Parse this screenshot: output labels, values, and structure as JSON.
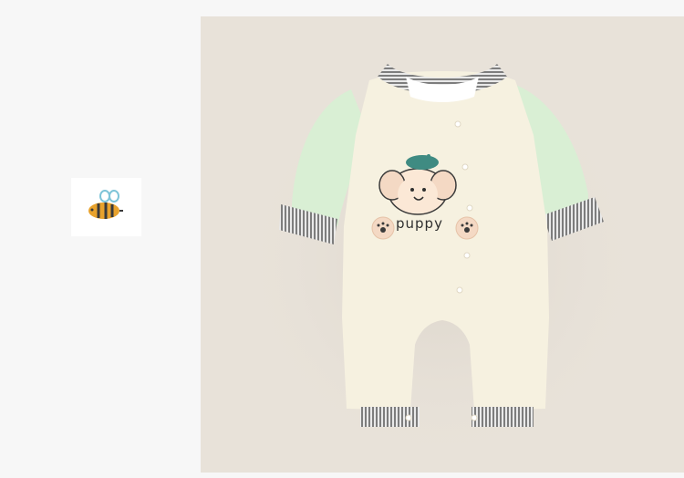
{
  "thumbnail": {
    "icon": "bee-icon"
  },
  "product_photo": {
    "print_text": "puppy",
    "colors": {
      "background": "#e8e2d9",
      "body": "#f6f1e0",
      "sleeves": "#d9efd4",
      "stripe_dark": "#7d7d7d",
      "stripe_light": "#e9e9e9",
      "beret": "#3f8b82"
    }
  }
}
